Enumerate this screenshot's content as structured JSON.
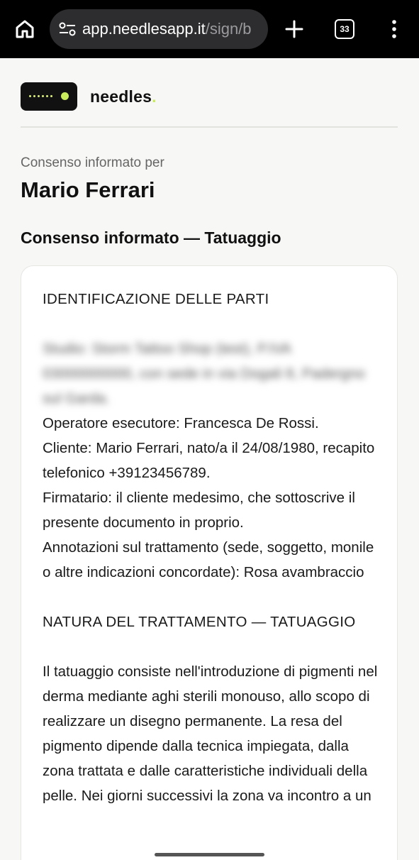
{
  "browser": {
    "url_host": "app.needlesapp.it",
    "url_path": "/sign/b",
    "tab_count": "33"
  },
  "brand": {
    "name": "needles",
    "name_accent": ".",
    "accent_color": "#c9ec5c"
  },
  "header": {
    "kicker": "Consenso informato per",
    "client_name": "Mario Ferrari",
    "document_title": "Consenso informato — Tatuaggio"
  },
  "document": {
    "section1_title": "IDENTIFICAZIONE DELLE PARTI",
    "studio_redacted": "Studio: Storm Tattoo Shop (test), P.IVA 03000000000, con sede in via Dogali 8, Padergno sul Garda.",
    "operator": "Operatore esecutore: Francesca De Rossi.",
    "client": "Cliente: Mario Ferrari, nato/a il 24/08/1980, recapito telefonico +39123456789.",
    "signer": "Firmatario: il cliente medesimo, che sottoscrive il presente documento in proprio.",
    "notes": "Annotazioni sul trattamento (sede, soggetto, monile o altre indicazioni concordate): Rosa avambraccio",
    "section2_title": "NATURA DEL TRATTAMENTO — TATUAGGIO",
    "section2_body": "Il tatuaggio consiste nell'introduzione di pigmenti nel derma mediante aghi sterili monouso, allo scopo di realizzare un disegno permanente. La resa del pigmento dipende dalla tecnica impiegata, dalla zona trattata e dalle caratteristiche individuali della pelle. Nei giorni successivi la zona va incontro a un"
  },
  "icons": {
    "home": "home-icon",
    "site_settings": "tune-icon",
    "new_tab": "plus-icon",
    "tabs": "tab-switcher-icon",
    "menu": "more-vert-icon"
  }
}
